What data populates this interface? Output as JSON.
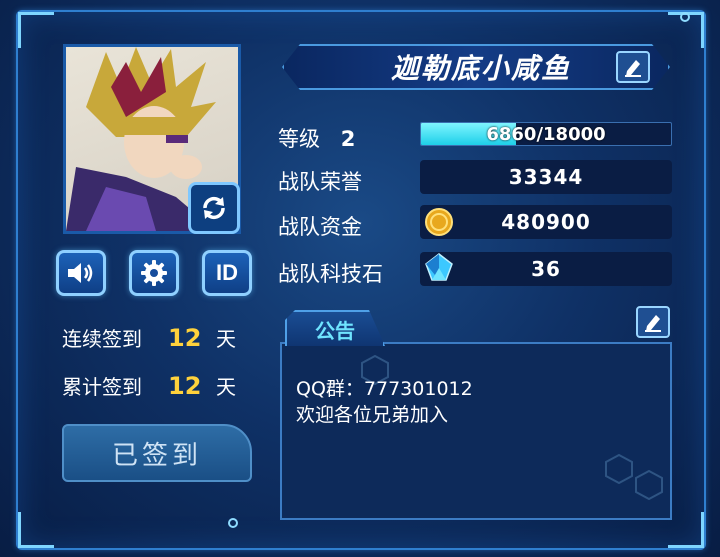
{
  "player": {
    "name": "迦勒底小咸鱼"
  },
  "stats": {
    "level_label": "等级",
    "level_value": "2",
    "xp_text": "6860/18000",
    "xp_progress": 0.381,
    "honor_label": "战队荣誉",
    "honor_value": "33344",
    "funds_label": "战队资金",
    "funds_value": "480900",
    "tech_label": "战队科技石",
    "tech_value": "36"
  },
  "toolbar": {
    "id_label": "ID"
  },
  "signin": {
    "consecutive_label": "连续签到",
    "consecutive_value": "12",
    "total_label": "累计签到",
    "total_value": "12",
    "unit": "天",
    "button_label": "已签到"
  },
  "notice": {
    "tab_label": "公告",
    "line1": "QQ群：777301012",
    "line2": "欢迎各位兄弟加入"
  },
  "colors": {
    "accent_cyan": "#6fe4ff",
    "highlight_yellow": "#ffd23c",
    "panel_bg": "#0d2a5a"
  }
}
